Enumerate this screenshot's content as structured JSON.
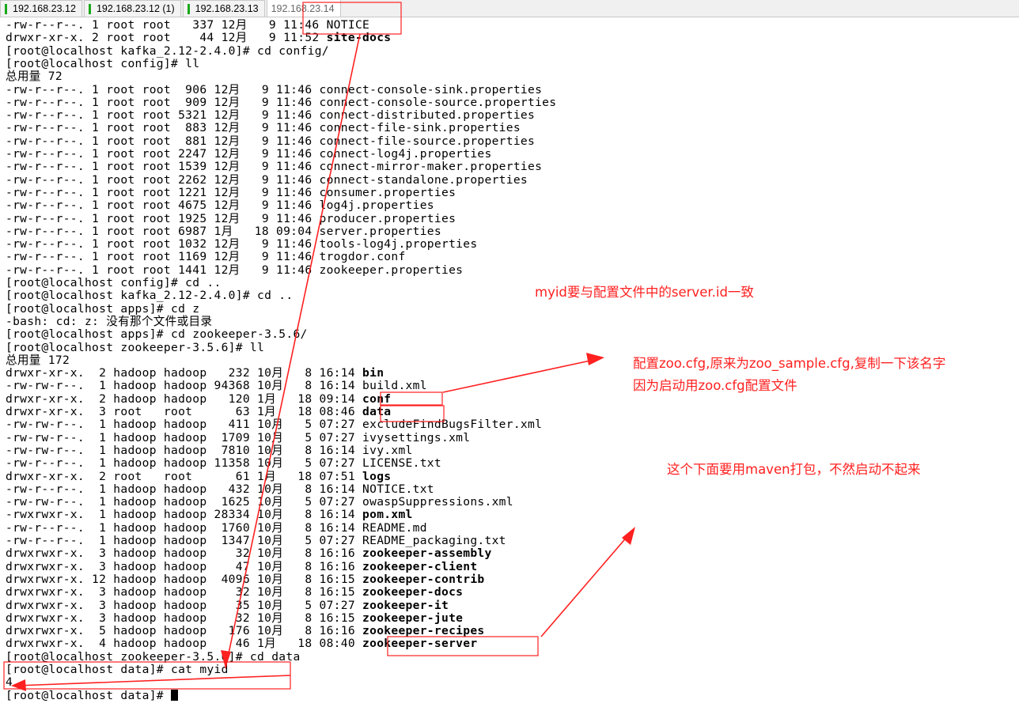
{
  "tabs": [
    {
      "label": "192.168.23.12",
      "indicator": true,
      "active": false
    },
    {
      "label": "192.168.23.12 (1)",
      "indicator": true,
      "active": false
    },
    {
      "label": "192.168.23.13",
      "indicator": true,
      "active": false
    },
    {
      "label": "192.168.23.14",
      "indicator": false,
      "active": true
    }
  ],
  "terminal": {
    "lines": [
      [
        "-rw-r--r--. 1 root root   337 12月   9 11:46 NOTICE",
        ""
      ],
      [
        "drwxr-xr-x. 2 root root    44 12月   9 11:52 ",
        "site-docs"
      ],
      [
        "[root@localhost kafka_2.12-2.4.0]# cd config/",
        ""
      ],
      [
        "[root@localhost config]# ll",
        ""
      ],
      [
        "总用量 72",
        ""
      ],
      [
        "-rw-r--r--. 1 root root  906 12月   9 11:46 connect-console-sink.properties",
        ""
      ],
      [
        "-rw-r--r--. 1 root root  909 12月   9 11:46 connect-console-source.properties",
        ""
      ],
      [
        "-rw-r--r--. 1 root root 5321 12月   9 11:46 connect-distributed.properties",
        ""
      ],
      [
        "-rw-r--r--. 1 root root  883 12月   9 11:46 connect-file-sink.properties",
        ""
      ],
      [
        "-rw-r--r--. 1 root root  881 12月   9 11:46 connect-file-source.properties",
        ""
      ],
      [
        "-rw-r--r--. 1 root root 2247 12月   9 11:46 connect-log4j.properties",
        ""
      ],
      [
        "-rw-r--r--. 1 root root 1539 12月   9 11:46 connect-mirror-maker.properties",
        ""
      ],
      [
        "-rw-r--r--. 1 root root 2262 12月   9 11:46 connect-standalone.properties",
        ""
      ],
      [
        "-rw-r--r--. 1 root root 1221 12月   9 11:46 consumer.properties",
        ""
      ],
      [
        "-rw-r--r--. 1 root root 4675 12月   9 11:46 log4j.properties",
        ""
      ],
      [
        "-rw-r--r--. 1 root root 1925 12月   9 11:46 producer.properties",
        ""
      ],
      [
        "-rw-r--r--. 1 root root 6987 1月   18 09:04 server.properties",
        ""
      ],
      [
        "-rw-r--r--. 1 root root 1032 12月   9 11:46 tools-log4j.properties",
        ""
      ],
      [
        "-rw-r--r--. 1 root root 1169 12月   9 11:46 trogdor.conf",
        ""
      ],
      [
        "-rw-r--r--. 1 root root 1441 12月   9 11:46 zookeeper.properties",
        ""
      ],
      [
        "[root@localhost config]# cd ..",
        ""
      ],
      [
        "[root@localhost kafka_2.12-2.4.0]# cd ..",
        ""
      ],
      [
        "[root@localhost apps]# cd z",
        ""
      ],
      [
        "-bash: cd: z: 没有那个文件或目录",
        ""
      ],
      [
        "[root@localhost apps]# cd zookeeper-3.5.6/",
        ""
      ],
      [
        "[root@localhost zookeeper-3.5.6]# ll",
        ""
      ],
      [
        "总用量 172",
        ""
      ],
      [
        "drwxr-xr-x.  2 hadoop hadoop   232 10月   8 16:14 ",
        "bin"
      ],
      [
        "-rw-rw-r--.  1 hadoop hadoop 94368 10月   8 16:14 build.xml",
        ""
      ],
      [
        "drwxr-xr-x.  2 hadoop hadoop   120 1月   18 09:14 ",
        "conf"
      ],
      [
        "drwxr-xr-x.  3 root   root      63 1月   18 08:46 ",
        "data"
      ],
      [
        "-rw-rw-r--.  1 hadoop hadoop   411 10月   5 07:27 excludeFindBugsFilter.xml",
        ""
      ],
      [
        "-rw-rw-r--.  1 hadoop hadoop  1709 10月   5 07:27 ivysettings.xml",
        ""
      ],
      [
        "-rw-rw-r--.  1 hadoop hadoop  7810 10月   8 16:14 ivy.xml",
        ""
      ],
      [
        "-rw-r--r--.  1 hadoop hadoop 11358 10月   5 07:27 LICENSE.txt",
        ""
      ],
      [
        "drwxr-xr-x.  2 root   root      61 1月   18 07:51 ",
        "logs"
      ],
      [
        "-rw-r--r--.  1 hadoop hadoop   432 10月   8 16:14 NOTICE.txt",
        ""
      ],
      [
        "-rw-rw-r--.  1 hadoop hadoop  1625 10月   5 07:27 owaspSuppressions.xml",
        ""
      ],
      [
        "-rwxrwxr-x.  1 hadoop hadoop 28334 10月   8 16:14 ",
        "pom.xml"
      ],
      [
        "-rw-r--r--.  1 hadoop hadoop  1760 10月   8 16:14 README.md",
        ""
      ],
      [
        "-rw-r--r--.  1 hadoop hadoop  1347 10月   5 07:27 README_packaging.txt",
        ""
      ],
      [
        "drwxrwxr-x.  3 hadoop hadoop    32 10月   8 16:16 ",
        "zookeeper-assembly"
      ],
      [
        "drwxrwxr-x.  3 hadoop hadoop    47 10月   8 16:16 ",
        "zookeeper-client"
      ],
      [
        "drwxrwxr-x. 12 hadoop hadoop  4096 10月   8 16:15 ",
        "zookeeper-contrib"
      ],
      [
        "drwxrwxr-x.  3 hadoop hadoop    32 10月   8 16:15 ",
        "zookeeper-docs"
      ],
      [
        "drwxrwxr-x.  3 hadoop hadoop    35 10月   5 07:27 ",
        "zookeeper-it"
      ],
      [
        "drwxrwxr-x.  3 hadoop hadoop    32 10月   8 16:15 ",
        "zookeeper-jute"
      ],
      [
        "drwxrwxr-x.  5 hadoop hadoop   176 10月   8 16:16 ",
        "zookeeper-recipes"
      ],
      [
        "drwxrwxr-x.  4 hadoop hadoop    46 1月   18 08:40 ",
        "zookeeper-server"
      ],
      [
        "[root@localhost zookeeper-3.5.6]# cd data",
        ""
      ],
      [
        "[root@localhost data]# cat myid",
        ""
      ],
      [
        "4",
        ""
      ],
      [
        "[root@localhost data]# ",
        ""
      ]
    ]
  },
  "annotations": {
    "note1": "myid要与配置文件中的server.id一致",
    "note2_line1": "配置zoo.cfg,原来为zoo_sample.cfg,复制一下该名字",
    "note2_line2": "因为启动用zoo.cfg配置文件",
    "note3": "这个下面要用maven打包，不然启动不起来",
    "color": "#ff2020"
  },
  "colors": {
    "tab_indicator": "#1aa81a",
    "terminal_bg": "#ffffff",
    "terminal_fg": "#000000"
  }
}
